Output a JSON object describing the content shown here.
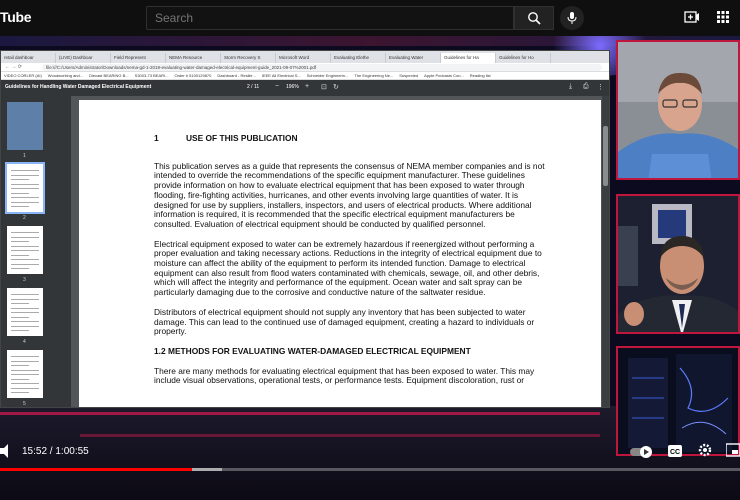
{
  "youtube": {
    "logo_text": "Tube",
    "search_placeholder": "Search",
    "time_current": "15:52",
    "time_total": "1:00:55",
    "time_display": "15:52 / 1:00:55",
    "progress_fraction": 0.26,
    "buffer_fraction": 0.3,
    "colors": {
      "progress": "#ff0000",
      "frame": "#c0163e"
    }
  },
  "browser": {
    "tabs": [
      "retail dashboar",
      "(LIVE) Dashboar",
      "Field Represent",
      "NEMA Resource",
      "Storm Recovery S",
      "Microsoft Word",
      "Evaluating Elethe",
      "Evaluating Water",
      "Guidelines for Ha",
      "Guidelines for Ho"
    ],
    "address": "file:///C:/Users/Administrator/Downloads/nema-gd-1-2019-evaluating-water-damaged-electrical-equipment-guide_2021-09-07%2001.pdf",
    "bookmarks": [
      "VIDEO CORLER (AI)",
      "Woodworking and...",
      "Diecast BEARING B...",
      "S3003-73 BEARI...",
      "Order # 5100129870",
      "Dashboard - Resilie...",
      "IEEE All Electrical S...",
      "Schneider Engineerin...",
      "The Engineering Ne...",
      "Suspected",
      "Apple Podcasts Con...",
      "Reading list"
    ]
  },
  "pdf": {
    "title": "Guidelines for Handling Water Damaged Electrical Equipment",
    "page_current": "2",
    "page_total": "/ 11",
    "zoom": "196%",
    "thumb_numbers": [
      "1",
      "2",
      "3",
      "4",
      "5"
    ]
  },
  "document": {
    "section_number": "1",
    "section_title": "USE OF THIS PUBLICATION",
    "paragraphs": [
      "This publication serves as a guide that represents the consensus of NEMA member companies and is not intended to override the recommendations of the specific equipment manufacturer. These guidelines provide information on how to evaluate electrical equipment that has been exposed to water through flooding, fire-fighting activities, hurricanes, and other events involving large quantities of water. It is designed for use by suppliers, installers, inspectors, and users of electrical products. Where additional information is required, it is recommended that the specific electrical equipment manufacturers be consulted. Evaluation of electrical equipment should be conducted by qualified personnel.",
      "Electrical equipment exposed to water can be extremely hazardous if reenergized without performing a proper evaluation and taking necessary actions. Reductions in the integrity of electrical equipment due to moisture can affect the ability of the equipment to perform its intended function. Damage to electrical equipment can also result from flood waters contaminated with chemicals, sewage, oil, and other debris, which will affect the integrity and performance of the equipment. Ocean water and salt spray can be particularly damaging due to the corrosive and conductive nature of the saltwater residue.",
      "Distributors of electrical equipment should not supply any inventory that has been subjected to water damage. This can lead to the continued use of damaged equipment, creating a hazard to individuals or property."
    ],
    "subsection_title": "1.2 METHODS FOR EVALUATING WATER-DAMAGED ELECTRICAL EQUIPMENT",
    "subsection_paragraph": "There are many methods for evaluating electrical equipment that has been exposed to water. This may include visual observations, operational tests, or performance tests. Equipment discoloration, rust or"
  }
}
